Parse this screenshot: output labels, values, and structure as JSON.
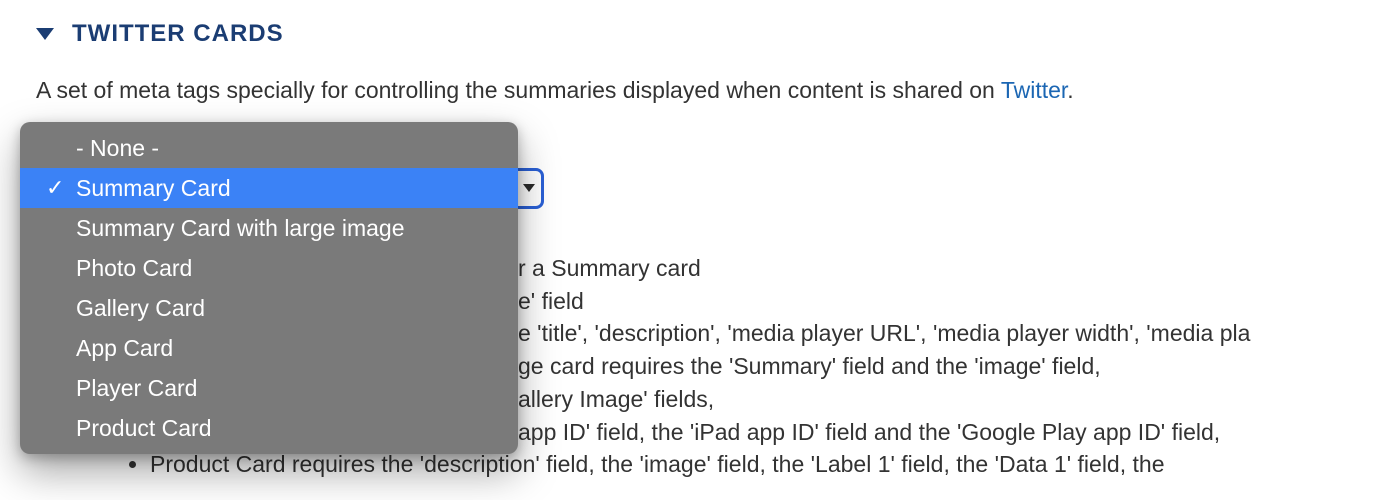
{
  "section": {
    "title": "TWITTER CARDS",
    "description_pre": "A set of meta tags specially for controlling the summaries displayed when content is shared on ",
    "description_link": "Twitter",
    "description_post": "."
  },
  "dropdown": {
    "options": [
      {
        "label": "- None -",
        "selected": false
      },
      {
        "label": "Summary Card",
        "selected": true
      },
      {
        "label": "Summary Card with large image",
        "selected": false
      },
      {
        "label": "Photo Card",
        "selected": false
      },
      {
        "label": "Gallery Card",
        "selected": false
      },
      {
        "label": "App Card",
        "selected": false
      },
      {
        "label": "Player Card",
        "selected": false
      },
      {
        "label": "Product Card",
        "selected": false
      }
    ]
  },
  "behind": {
    "line1": "r a Summary card",
    "line2": "e' field",
    "line3": "e 'title', 'description', 'media player URL', 'media player width', 'media pla",
    "line4": "ge card requires the 'Summary' field and the 'image' field,",
    "line5": "allery Image' fields,",
    "line6": " app ID' field, the 'iPad app ID' field and the 'Google Play app ID' field,"
  },
  "notes": {
    "item7": "Product Card requires the 'description' field, the 'image' field, the 'Label 1' field, the 'Data 1' field, the"
  }
}
